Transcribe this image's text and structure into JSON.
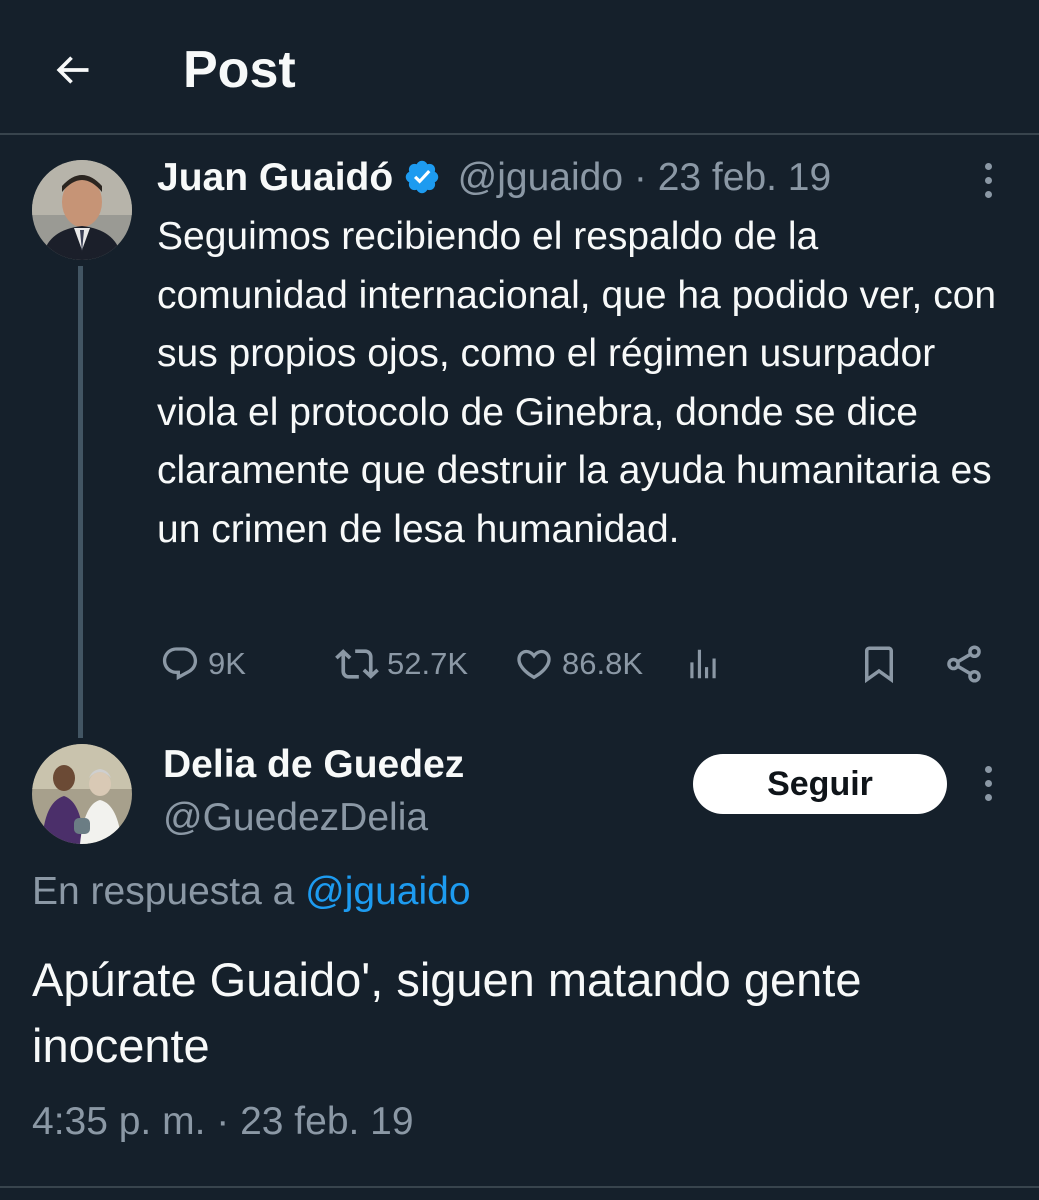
{
  "header": {
    "title": "Post",
    "back_icon": "arrow-left-icon"
  },
  "original_tweet": {
    "author_name": "Juan Guaidó",
    "verified": true,
    "handle": "@jguaido",
    "separator": " · ",
    "date": "23 feb. 19",
    "text": "Seguimos recibiendo el respaldo de la comunidad internacional, que ha podido ver, con sus propios ojos, como el régimen usurpador viola el protocolo de Ginebra, donde se dice claramente que destruir la ayuda humanitaria es un crimen de lesa humanidad.",
    "stats": {
      "replies": "9K",
      "retweets": "52.7K",
      "likes": "86.8K"
    }
  },
  "reply_tweet": {
    "author_name": "Delia  de Guedez",
    "handle": "@GuedezDelia",
    "follow_label": "Seguir",
    "in_reply_prefix": "En respuesta a ",
    "in_reply_to": "@jguaido",
    "text": "Apúrate Guaido', siguen matando gente inocente",
    "timestamp": "4:35 p. m. · 23 feb. 19"
  },
  "colors": {
    "background": "#15202b",
    "accent": "#1d9bf0",
    "muted": "#8b98a5",
    "divider": "#38444d"
  }
}
